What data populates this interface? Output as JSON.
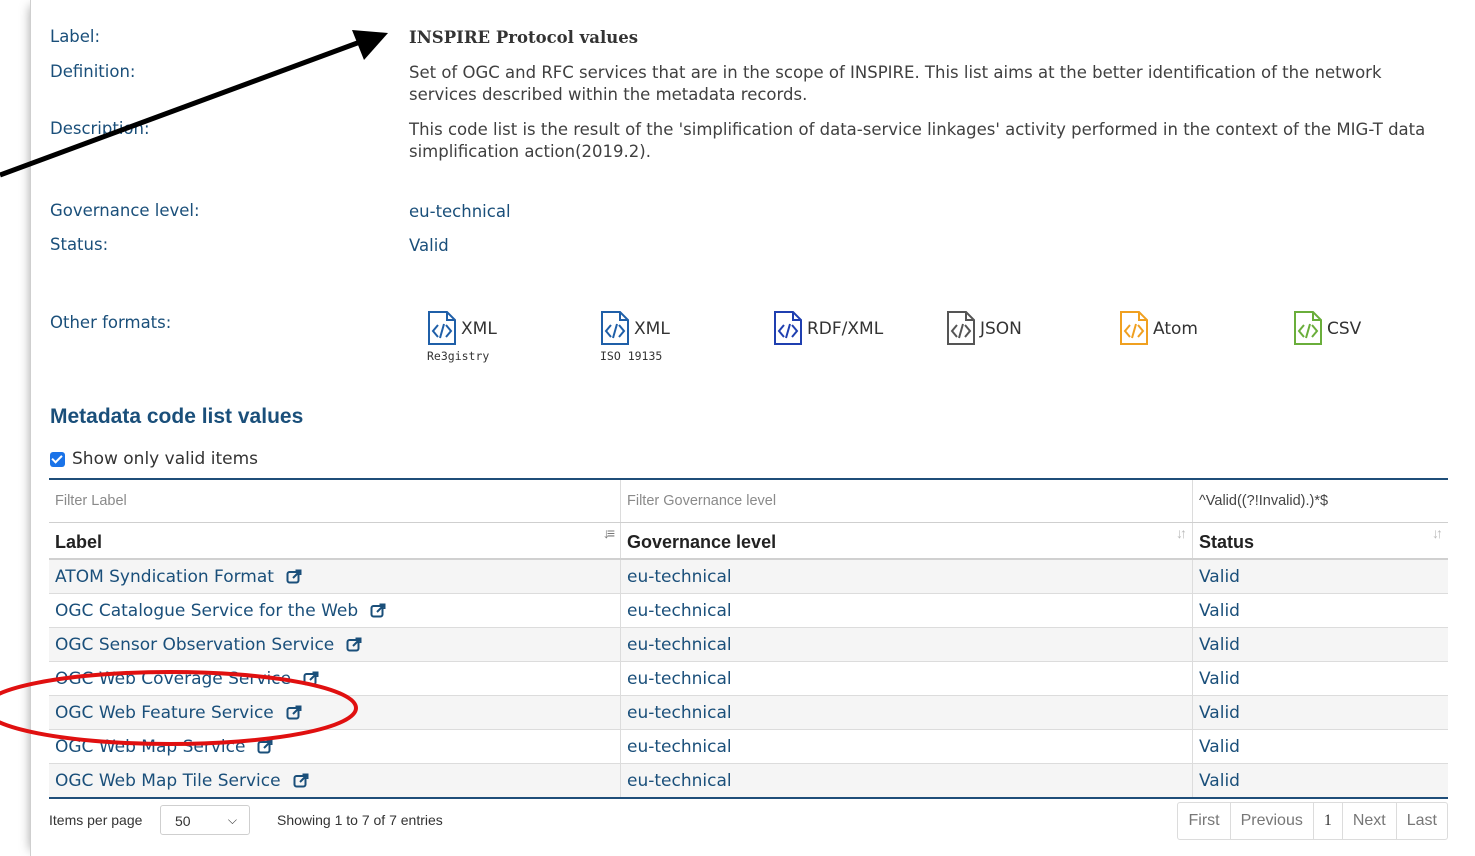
{
  "metadata": {
    "label_key": "Label:",
    "label_value": "INSPIRE Protocol values",
    "definition_key": "Definition:",
    "definition_value": "Set of OGC and RFC services that are in the scope of INSPIRE. This list aims at the better identification of the network services described within the metadata records.",
    "description_key": "Description:",
    "description_value": "This code list is the result of the 'simplification of data-service linkages' activity performed in the context of the MIG-T data simplification action(2019.2).",
    "governance_key": "Governance level:",
    "governance_value": "eu-technical",
    "status_key": "Status:",
    "status_value": "Valid",
    "formats_key": "Other formats:"
  },
  "formats": [
    {
      "name": "XML",
      "sub": "Re3gistry",
      "color": "#1f5fa8"
    },
    {
      "name": "XML",
      "sub": "ISO 19135",
      "color": "#1f5fa8"
    },
    {
      "name": "RDF/XML",
      "sub": "",
      "color": "#1f3fb0"
    },
    {
      "name": "JSON",
      "sub": "",
      "color": "#555555"
    },
    {
      "name": "Atom",
      "sub": "",
      "color": "#f0a020"
    },
    {
      "name": "CSV",
      "sub": "",
      "color": "#6aae3b"
    }
  ],
  "section_title": "Metadata code list values",
  "show_valid_label": "Show only valid items",
  "table": {
    "filter_label_placeholder": "Filter Label",
    "filter_governance_placeholder": "Filter Governance level",
    "filter_status_value": "^Valid((?!Invalid).)*$",
    "col_label": "Label",
    "col_governance": "Governance level",
    "col_status": "Status",
    "rows": [
      {
        "label": "ATOM Syndication Format",
        "governance": "eu-technical",
        "status": "Valid"
      },
      {
        "label": "OGC Catalogue Service for the Web",
        "governance": "eu-technical",
        "status": "Valid"
      },
      {
        "label": "OGC Sensor Observation Service",
        "governance": "eu-technical",
        "status": "Valid"
      },
      {
        "label": "OGC Web Coverage Service",
        "governance": "eu-technical",
        "status": "Valid"
      },
      {
        "label": "OGC Web Feature Service",
        "governance": "eu-technical",
        "status": "Valid"
      },
      {
        "label": "OGC Web Map Service",
        "governance": "eu-technical",
        "status": "Valid"
      },
      {
        "label": "OGC Web Map Tile Service",
        "governance": "eu-technical",
        "status": "Valid"
      }
    ]
  },
  "footer": {
    "items_per_page_label": "Items per page",
    "items_per_page_value": "50",
    "showing": "Showing 1 to 7 of 7 entries",
    "pager_first": "First",
    "pager_previous": "Previous",
    "pager_current": "1",
    "pager_next": "Next",
    "pager_last": "Last"
  },
  "colors": {
    "link": "#1a4f7a",
    "arrow": "#000000",
    "highlight_ellipse": "#e01010"
  }
}
